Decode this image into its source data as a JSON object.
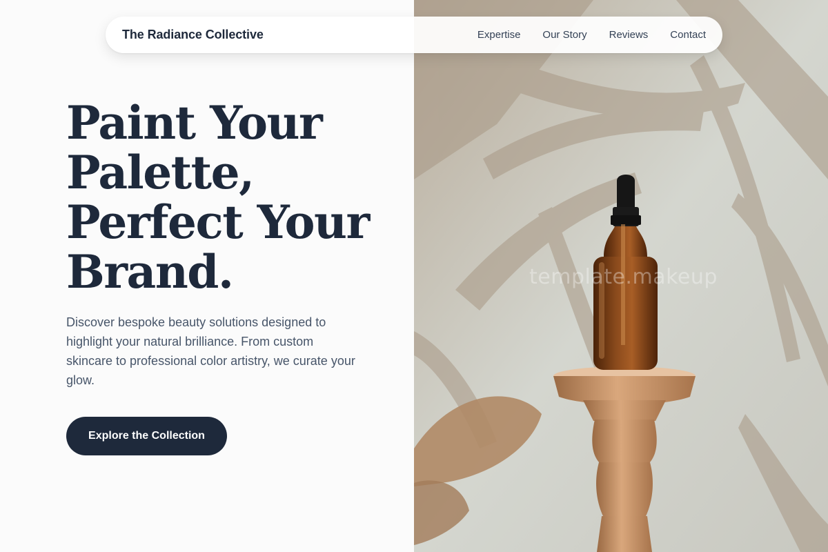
{
  "nav": {
    "brand": "The Radiance Collective",
    "links": [
      "Expertise",
      "Our Story",
      "Reviews",
      "Contact"
    ]
  },
  "hero": {
    "headline": [
      "Paint Your",
      "Palette,",
      "Perfect Your",
      "Brand."
    ],
    "description": "Discover bespoke beauty solutions designed to highlight your natural brilliance. From custom skincare to professional color artistry, we curate your glow.",
    "cta_label": "Explore the Collection"
  },
  "watermark": "template.makeup",
  "colors": {
    "primary": "#1e293b",
    "body_text": "#475569",
    "background": "#fbfbfb",
    "image_wall": "#cfcfc6",
    "amber_glass": "#7a3d14",
    "wood": "#c9956a"
  }
}
